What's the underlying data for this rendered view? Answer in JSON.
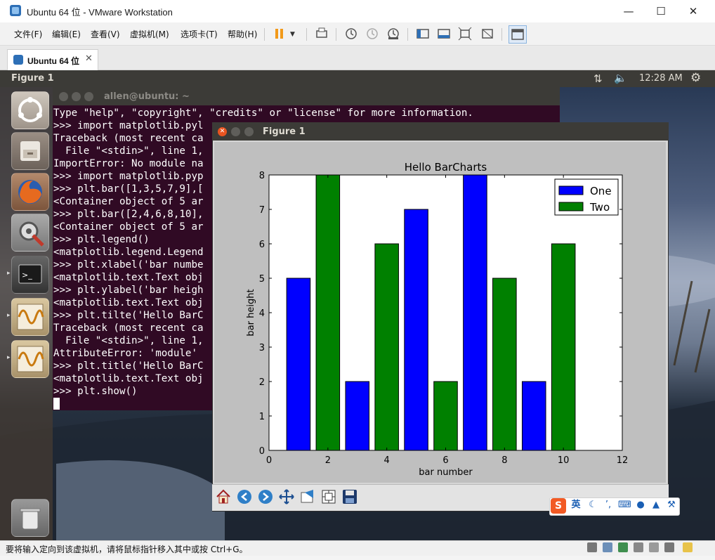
{
  "vmware": {
    "window_title": "Ubuntu 64 位 - VMware Workstation",
    "menu": [
      "文件(F)",
      "编辑(E)",
      "查看(V)",
      "虚拟机(M)",
      "选项卡(T)",
      "帮助(H)"
    ],
    "tab_label": "Ubuntu 64 位",
    "status_text": "要将输入定向到该虚拟机，请将鼠标指针移入其中或按 Ctrl+G。"
  },
  "ubuntu": {
    "topbar_title": "Figure 1",
    "clock": "12:28 AM"
  },
  "terminal": {
    "title": "allen@ubuntu: ~",
    "lines": [
      "Type \"help\", \"copyright\", \"credits\" or \"license\" for more information.",
      ">>> import matplotlib.pyl",
      "Traceback (most recent ca",
      "  File \"<stdin>\", line 1,",
      "ImportError: No module na",
      ">>> import matplotlib.pyp",
      ">>> plt.bar([1,3,5,7,9],[",
      "<Container object of 5 ar",
      ">>> plt.bar([2,4,6,8,10],",
      "<Container object of 5 ar",
      ">>> plt.legend()",
      "<matplotlib.legend.Legend",
      ">>> plt.xlabel('bar numbe",
      "<matplotlib.text.Text obj",
      ">>> plt.ylabel('bar heigh",
      "<matplotlib.text.Text obj",
      ">>> plt.tilte('Hello BarC",
      "Traceback (most recent ca",
      "  File \"<stdin>\", line 1,",
      "AttributeError: 'module' ",
      ">>> plt.title('Hello BarC",
      "<matplotlib.text.Text obj",
      ">>> plt.show()"
    ]
  },
  "figure": {
    "title": "Figure 1"
  },
  "ime": {
    "mode_label": "英"
  },
  "colors": {
    "series_one": "#0000ff",
    "series_two": "#008000",
    "terminal_bg": "#300a24",
    "ubuntu_panel": "#3c3b37"
  },
  "chart_data": {
    "type": "bar",
    "title": "Hello BarCharts",
    "xlabel": "bar number",
    "ylabel": "bar height",
    "xlim": [
      0,
      12
    ],
    "ylim": [
      0,
      8
    ],
    "xticks": [
      "0",
      "2",
      "4",
      "6",
      "8",
      "10",
      "12"
    ],
    "yticks": [
      "0",
      "1",
      "2",
      "3",
      "4",
      "5",
      "6",
      "7",
      "8"
    ],
    "legend_position": "top-right",
    "grid": false,
    "bar_width": 0.8,
    "series": [
      {
        "name": "One",
        "color": "#0000ff",
        "x": [
          1,
          3,
          5,
          7,
          9
        ],
        "values": [
          5,
          2,
          7,
          8,
          2
        ]
      },
      {
        "name": "Two",
        "color": "#008000",
        "x": [
          2,
          4,
          6,
          8,
          10
        ],
        "values": [
          8,
          6,
          2,
          5,
          6
        ]
      }
    ]
  }
}
